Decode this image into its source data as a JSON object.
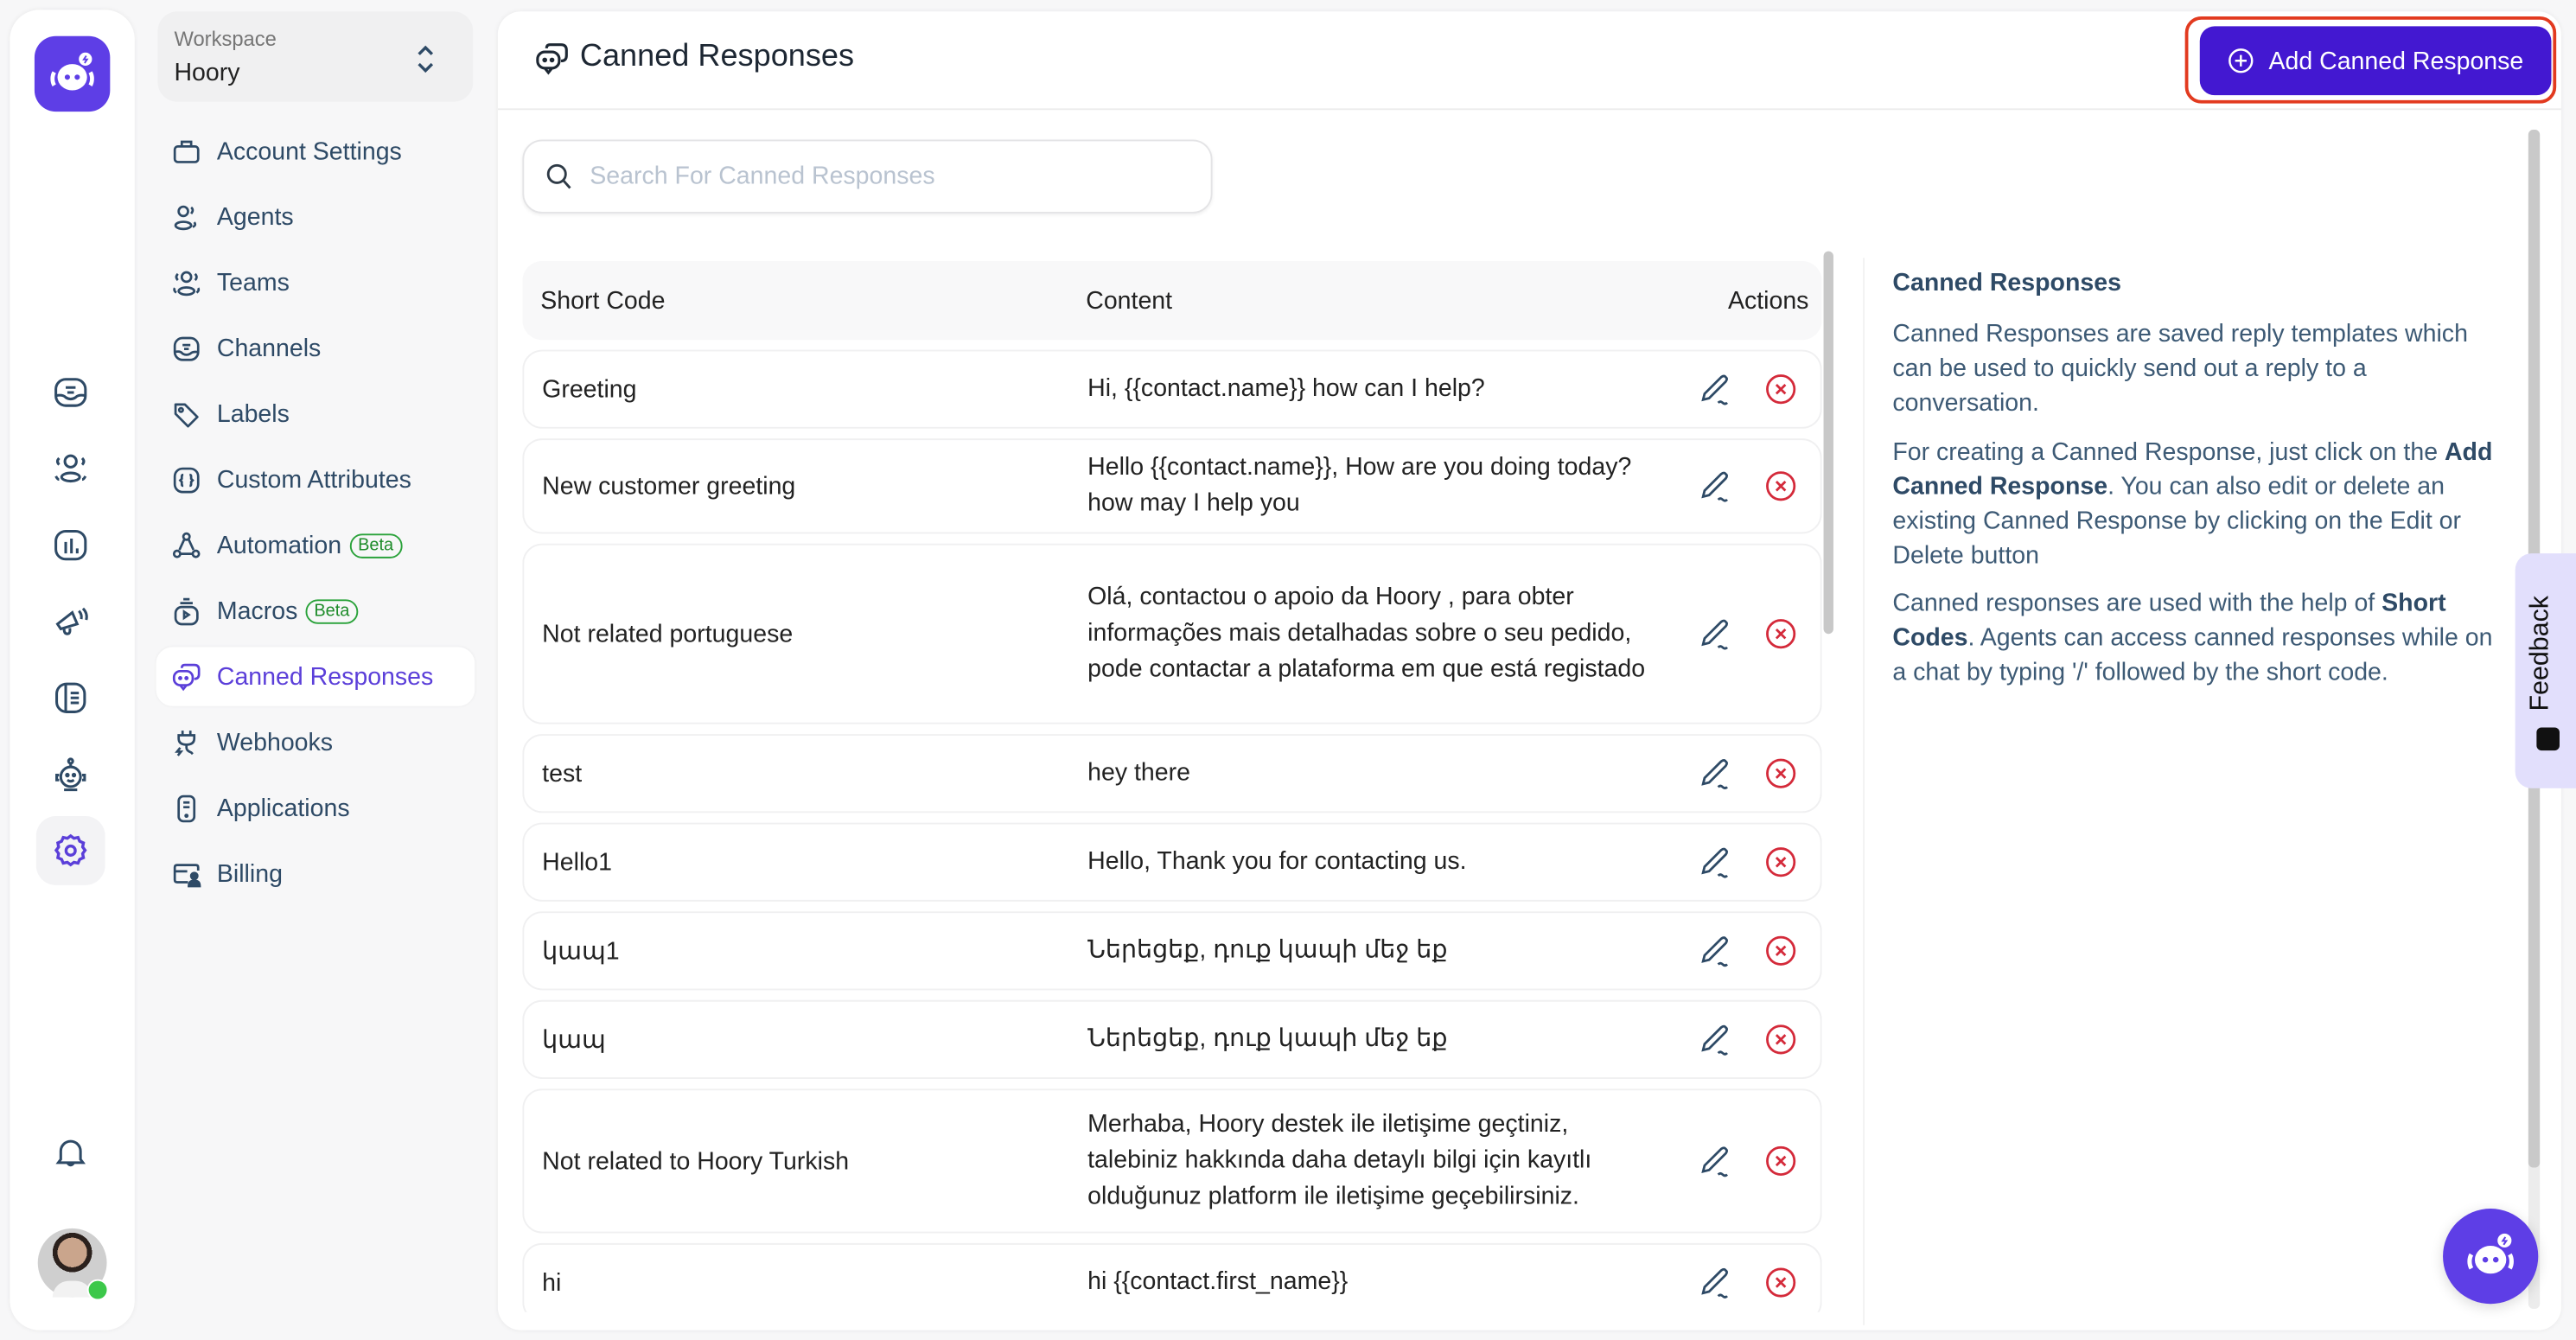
{
  "colors": {
    "brand": "#5e3ee6",
    "primary_button": "#4318d1",
    "active_nav": "#5b3fd9",
    "danger": "#d42a3a",
    "beta": "#2aa23a",
    "highlight_outline": "#e23a1f"
  },
  "rail": {
    "logo": "hoory-bot-logo",
    "items": [
      {
        "name": "conversations",
        "icon": "inbox-icon"
      },
      {
        "name": "contacts",
        "icon": "contacts-icon"
      },
      {
        "name": "reports",
        "icon": "bar-chart-icon"
      },
      {
        "name": "campaigns",
        "icon": "megaphone-icon"
      },
      {
        "name": "help-center",
        "icon": "book-icon"
      },
      {
        "name": "bot",
        "icon": "robot-icon"
      },
      {
        "name": "settings",
        "icon": "gear-icon",
        "active": true
      }
    ],
    "notifications_icon": "bell-icon",
    "avatar_status": "online"
  },
  "workspace": {
    "label": "Workspace",
    "value": "Hoory"
  },
  "sidebar": {
    "items": [
      {
        "label": "Account Settings",
        "icon": "briefcase-icon"
      },
      {
        "label": "Agents",
        "icon": "agents-icon"
      },
      {
        "label": "Teams",
        "icon": "teams-icon"
      },
      {
        "label": "Channels",
        "icon": "inbox-icon"
      },
      {
        "label": "Labels",
        "icon": "tag-icon"
      },
      {
        "label": "Custom Attributes",
        "icon": "braces-icon"
      },
      {
        "label": "Automation",
        "icon": "automation-icon",
        "badge": "Beta"
      },
      {
        "label": "Macros",
        "icon": "macros-icon",
        "badge": "Beta"
      },
      {
        "label": "Canned Responses",
        "icon": "chat-bubbles-icon",
        "active": true
      },
      {
        "label": "Webhooks",
        "icon": "plug-icon"
      },
      {
        "label": "Applications",
        "icon": "phone-app-icon"
      },
      {
        "label": "Billing",
        "icon": "billing-icon"
      }
    ]
  },
  "header": {
    "title": "Canned Responses",
    "add_button": "Add Canned Response"
  },
  "search": {
    "placeholder": "Search For Canned Responses",
    "value": ""
  },
  "table": {
    "columns": [
      "Short Code",
      "Content",
      "Actions"
    ],
    "rows": [
      {
        "short_code": "Greeting",
        "content": "Hi, {{contact.name}} how can I help?"
      },
      {
        "short_code": "New customer greeting",
        "content": "Hello {{contact.name}}, How are you doing today? how may I help you"
      },
      {
        "short_code": "Not related portuguese",
        "content": "Olá, contactou o apoio da Hoory , para obter informações mais detalhadas sobre o seu pedido, pode contactar a plataforma em que está registado"
      },
      {
        "short_code": "test",
        "content": "hey there"
      },
      {
        "short_code": "Hello1",
        "content": "Hello, Thank you for contacting us."
      },
      {
        "short_code": "կապ1",
        "content": "Ներեցեք, դուք կապի մեջ եք"
      },
      {
        "short_code": "կապ",
        "content": "Ներեցեք, դուք կապի մեջ եք"
      },
      {
        "short_code": "Not related to Hoory Turkish",
        "content": "Merhaba, Hoory destek ile iletişime geçtiniz, talebiniz hakkında daha detaylı bilgi için kayıtlı olduğunuz platform ile iletişime geçebilirsiniz."
      },
      {
        "short_code": "hi",
        "content": "hi {{contact.first_name}}"
      }
    ],
    "edit_icon": "pencil-icon",
    "delete_icon": "x-circle-icon"
  },
  "info": {
    "title": "Canned Responses",
    "p1": "Canned Responses are saved reply templates which can be used to quickly send out a reply to a conversation.",
    "p2_pre": "For creating a Canned Response, just click on the ",
    "p2_bold": "Add Canned Response",
    "p2_post": ". You can also edit or delete an existing Canned Response by clicking on the Edit or Delete button",
    "p3_pre": "Canned responses are used with the help of ",
    "p3_bold": "Short Codes",
    "p3_post": ". Agents can access canned responses while on a chat by typing '/' followed by the short code."
  },
  "feedback": {
    "label": "Feedback"
  }
}
